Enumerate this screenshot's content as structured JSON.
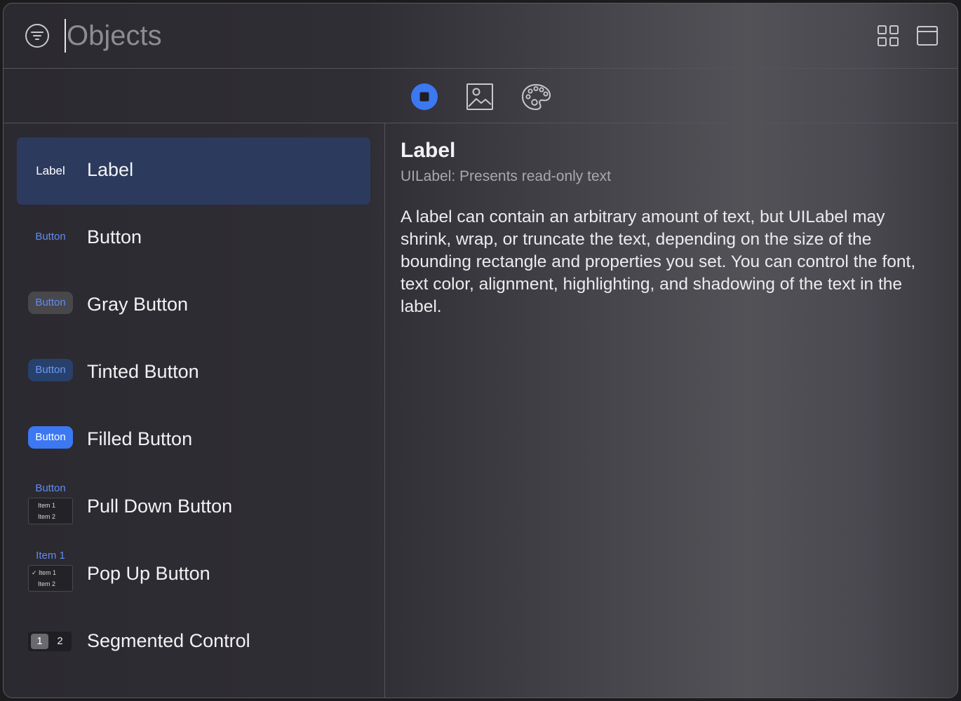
{
  "search": {
    "value": "",
    "placeholder": "Objects"
  },
  "header": {
    "left_icon": "filter-icon",
    "right_icons": [
      "grid-view-icon",
      "window-icon"
    ]
  },
  "tabs": [
    {
      "name": "objects-tab",
      "icon": "stop-circle-icon",
      "selected": true
    },
    {
      "name": "media-tab",
      "icon": "image-icon",
      "selected": false
    },
    {
      "name": "colors-tab",
      "icon": "palette-icon",
      "selected": false
    }
  ],
  "list": {
    "items": [
      {
        "title": "Label",
        "thumb_text": "Label",
        "selected": true
      },
      {
        "title": "Button",
        "thumb_text": "Button"
      },
      {
        "title": "Gray Button",
        "thumb_text": "Button"
      },
      {
        "title": "Tinted Button",
        "thumb_text": "Button"
      },
      {
        "title": "Filled Button",
        "thumb_text": "Button"
      },
      {
        "title": "Pull Down Button",
        "thumb_text": "Button",
        "menu_items": [
          "Item 1",
          "Item 2"
        ]
      },
      {
        "title": "Pop Up Button",
        "thumb_text": "Item 1",
        "menu_items": [
          "✓ Item 1",
          "Item 2"
        ]
      },
      {
        "title": "Segmented Control",
        "segments": [
          "1",
          "2"
        ]
      }
    ]
  },
  "detail": {
    "title": "Label",
    "subtitle": "UILabel: Presents read-only text",
    "description": "A label can contain an arbitrary amount of text, but UILabel may shrink, wrap, or truncate the text, depending on the size of the bounding rectangle and properties you set. You can control the font, text color, alignment, highlighting, and shadowing of the text in the label."
  },
  "colors": {
    "accent": "#3c78f2",
    "link": "#5f8cf0",
    "selection": "#2c3a5e"
  }
}
